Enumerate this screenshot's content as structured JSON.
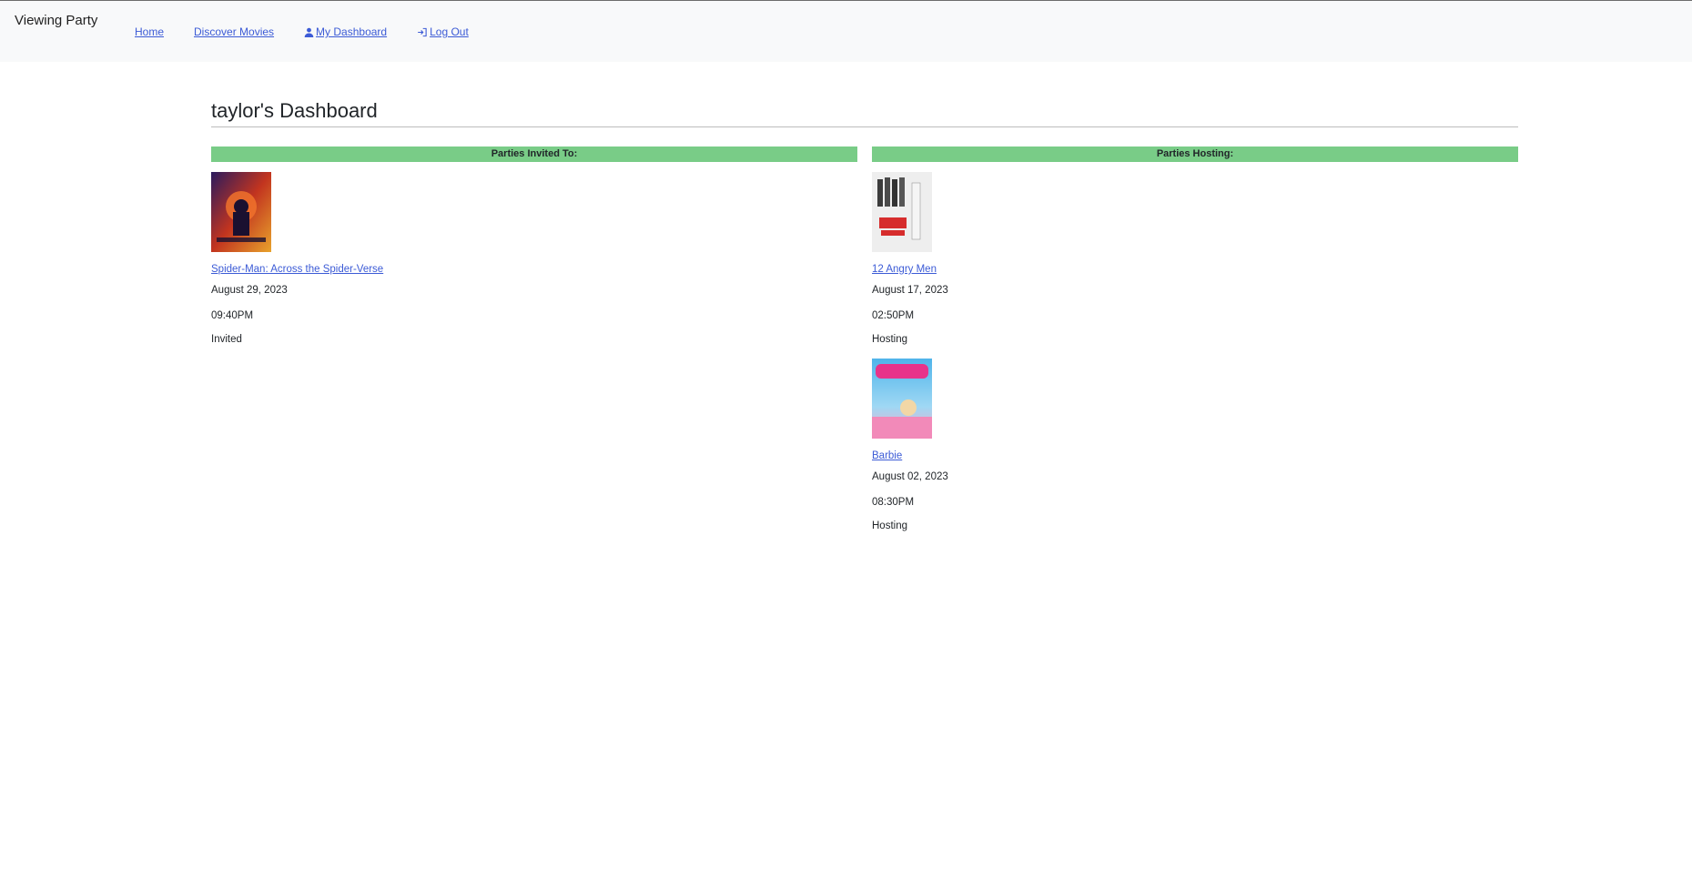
{
  "nav": {
    "brand": "Viewing Party",
    "links": [
      {
        "label": "Home",
        "icon": null
      },
      {
        "label": "Discover Movies",
        "icon": null
      },
      {
        "label": "My Dashboard",
        "icon": "user-icon"
      },
      {
        "label": "Log Out",
        "icon": "log-out-icon"
      }
    ]
  },
  "dashboard": {
    "title": "taylor's Dashboard"
  },
  "invited": {
    "header": "Parties Invited To:",
    "parties": [
      {
        "movie": "Spider-Man: Across the Spider-Verse",
        "date": "August 29, 2023",
        "time": "09:40PM",
        "status": "Invited"
      }
    ]
  },
  "hosting": {
    "header": "Parties Hosting:",
    "parties": [
      {
        "movie": "12 Angry Men",
        "date": "August 17, 2023",
        "time": "02:50PM",
        "status": "Hosting"
      },
      {
        "movie": "Barbie",
        "date": "August 02, 2023",
        "time": "08:30PM",
        "status": "Hosting"
      }
    ]
  },
  "colors": {
    "nav_bg": "#f8f9fa",
    "link": "#3c5bd6",
    "header_green": "#79cc87"
  }
}
